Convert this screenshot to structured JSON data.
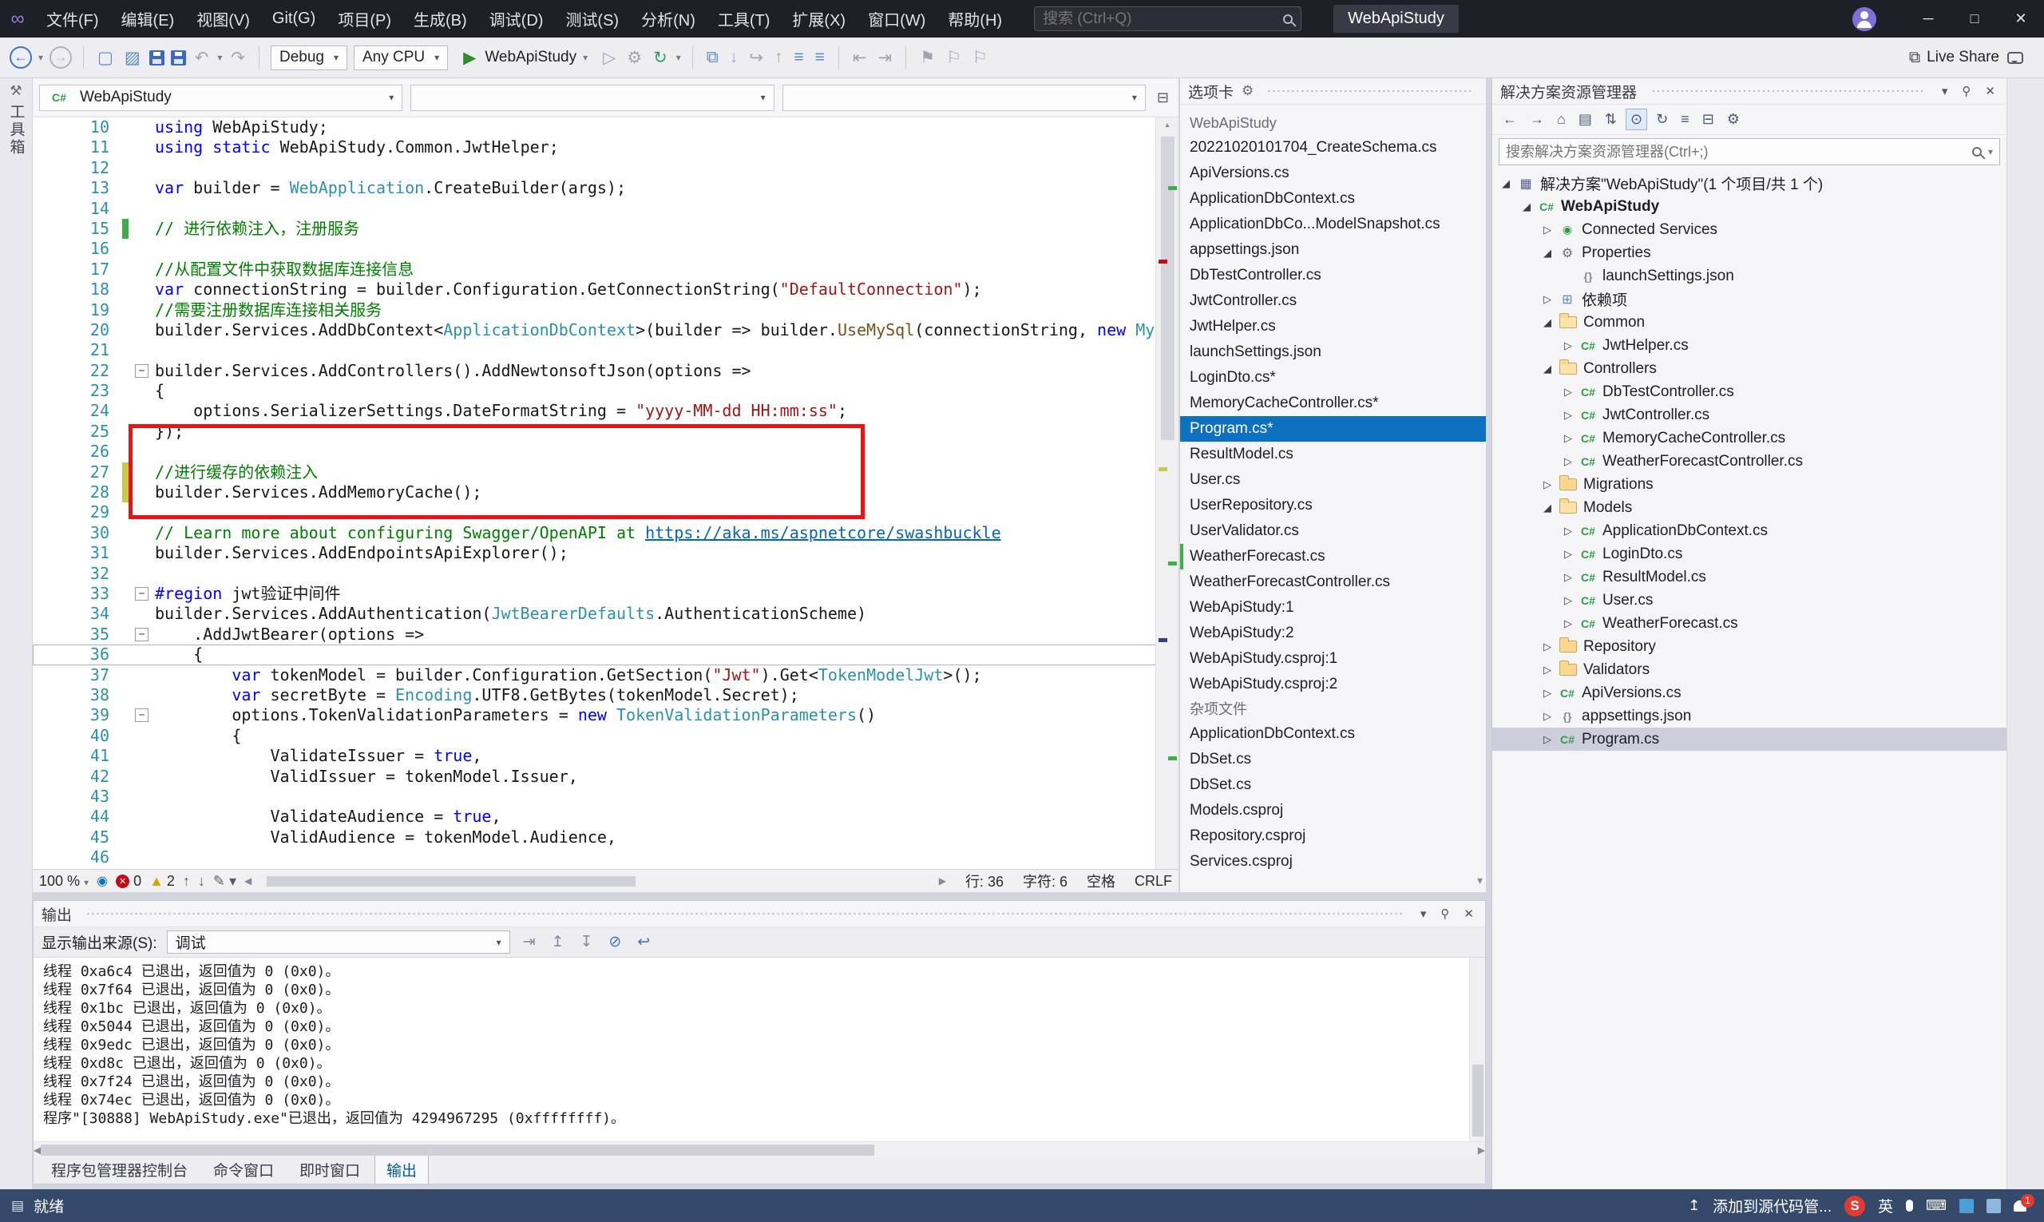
{
  "colors": {
    "accent": "#0e70c0",
    "selection_gray": "#cccedb",
    "error_red": "#c50b17",
    "changed_green": "#3fae49",
    "modified_yellow": "#c9c94a",
    "annotation_red": "#ee1111"
  },
  "titlebar": {
    "menus": [
      "文件(F)",
      "编辑(E)",
      "视图(V)",
      "Git(G)",
      "项目(P)",
      "生成(B)",
      "调试(D)",
      "测试(S)",
      "分析(N)",
      "工具(T)",
      "扩展(X)",
      "窗口(W)",
      "帮助(H)"
    ],
    "search_placeholder": "搜索 (Ctrl+Q)",
    "window_title": "WebApiStudy"
  },
  "toolbar": {
    "debug_config": "Debug",
    "platform": "Any CPU",
    "run_target": "WebApiStudy",
    "live_share": "Live Share"
  },
  "left_strip": {
    "toolbox": "工具箱"
  },
  "editor": {
    "nav": {
      "project": "WebApiStudy"
    },
    "status": {
      "zoom": "100 %",
      "errors": "0",
      "warnings": "2",
      "line": "行: 36",
      "col": "字符: 6",
      "space": "空格",
      "eol": "CRLF"
    },
    "code": {
      "lines": [
        {
          "n": 10,
          "toks": [
            [
              "k",
              "using"
            ],
            [
              "pl",
              " WebApiStudy;"
            ]
          ]
        },
        {
          "n": 11,
          "toks": [
            [
              "k",
              "using"
            ],
            [
              "pl",
              " "
            ],
            [
              "k",
              "static"
            ],
            [
              "pl",
              " WebApiStudy.Common.JwtHelper;"
            ]
          ]
        },
        {
          "n": 12,
          "toks": []
        },
        {
          "n": 13,
          "toks": [
            [
              "k",
              "var"
            ],
            [
              "pl",
              " builder = "
            ],
            [
              "ty",
              "WebApplication"
            ],
            [
              "pl",
              ".CreateBuilder(args);"
            ]
          ]
        },
        {
          "n": 14,
          "toks": []
        },
        {
          "n": 15,
          "toks": [
            [
              "cm",
              "// 进行依赖注入，注册服务"
            ]
          ],
          "chg": "green"
        },
        {
          "n": 16,
          "toks": []
        },
        {
          "n": 17,
          "toks": [
            [
              "cm",
              "//从配置文件中获取数据库连接信息"
            ]
          ]
        },
        {
          "n": 18,
          "toks": [
            [
              "k",
              "var"
            ],
            [
              "pl",
              " connectionString = builder.Configuration.GetConnectionString("
            ],
            [
              "st",
              "\"DefaultConnection\""
            ],
            [
              "pl",
              ");"
            ]
          ]
        },
        {
          "n": 19,
          "toks": [
            [
              "cm",
              "//需要注册数据库连接相关服务"
            ]
          ]
        },
        {
          "n": 20,
          "toks": [
            [
              "pl",
              "builder.Services.AddDbContext<"
            ],
            [
              "ty",
              "ApplicationDbContext"
            ],
            [
              "pl",
              ">(builder => builder."
            ],
            [
              "me",
              "UseMySql"
            ],
            [
              "pl",
              "(connectionString, "
            ],
            [
              "k",
              "new"
            ],
            [
              "pl",
              " "
            ],
            [
              "ty",
              "MySqlServerVersion"
            ],
            [
              "pl",
              "("
            ],
            [
              "k",
              "new"
            ]
          ]
        },
        {
          "n": 21,
          "toks": []
        },
        {
          "n": 22,
          "toks": [
            [
              "pl",
              "builder.Services.AddControllers().AddNewtonsoftJson(options =>"
            ]
          ],
          "fold": true
        },
        {
          "n": 23,
          "toks": [
            [
              "pl",
              "{"
            ]
          ]
        },
        {
          "n": 24,
          "toks": [
            [
              "pl",
              "    options.SerializerSettings.DateFormatString = "
            ],
            [
              "st",
              "\"yyyy-MM-dd HH:mm:ss\""
            ],
            [
              "pl",
              ";"
            ]
          ]
        },
        {
          "n": 25,
          "toks": [
            [
              "pl",
              "});"
            ]
          ]
        },
        {
          "n": 26,
          "toks": []
        },
        {
          "n": 27,
          "toks": [
            [
              "cm",
              "//进行缓存的依赖注入"
            ]
          ],
          "chg": "yellow"
        },
        {
          "n": 28,
          "toks": [
            [
              "pl",
              "builder.Services.AddMemoryCache();"
            ]
          ],
          "chg": "yellow"
        },
        {
          "n": 29,
          "toks": []
        },
        {
          "n": 30,
          "toks": [
            [
              "cm",
              "// Learn more about configuring Swagger/OpenAPI at "
            ],
            [
              "ur",
              "https://aka.ms/aspnetcore/swashbuckle"
            ]
          ]
        },
        {
          "n": 31,
          "toks": [
            [
              "pl",
              "builder.Services.AddEndpointsApiExplorer();"
            ]
          ]
        },
        {
          "n": 32,
          "toks": []
        },
        {
          "n": 33,
          "toks": [
            [
              "k",
              "#region"
            ],
            [
              "pl",
              " jwt验证中间件"
            ]
          ],
          "fold": true
        },
        {
          "n": 34,
          "toks": [
            [
              "pl",
              "builder.Services.AddAuthentication("
            ],
            [
              "ty",
              "JwtBearerDefaults"
            ],
            [
              "pl",
              ".AuthenticationScheme)"
            ]
          ]
        },
        {
          "n": 35,
          "toks": [
            [
              "pl",
              "    .AddJwtBearer(options =>"
            ]
          ],
          "fold": true
        },
        {
          "n": 36,
          "toks": [
            [
              "pl",
              "    {"
            ]
          ],
          "cur": true
        },
        {
          "n": 37,
          "toks": [
            [
              "pl",
              "        "
            ],
            [
              "k",
              "var"
            ],
            [
              "pl",
              " tokenModel = builder.Configuration.GetSection("
            ],
            [
              "st",
              "\"Jwt\""
            ],
            [
              "pl",
              ").Get<"
            ],
            [
              "ty",
              "TokenModelJwt"
            ],
            [
              "pl",
              ">();"
            ]
          ]
        },
        {
          "n": 38,
          "toks": [
            [
              "pl",
              "        "
            ],
            [
              "k",
              "var"
            ],
            [
              "pl",
              " secretByte = "
            ],
            [
              "ty",
              "Encoding"
            ],
            [
              "pl",
              ".UTF8.GetBytes(tokenModel.Secret);"
            ]
          ]
        },
        {
          "n": 39,
          "toks": [
            [
              "pl",
              "        options.TokenValidationParameters = "
            ],
            [
              "k",
              "new"
            ],
            [
              "pl",
              " "
            ],
            [
              "ty",
              "TokenValidationParameters"
            ],
            [
              "pl",
              "()"
            ]
          ],
          "fold": true
        },
        {
          "n": 40,
          "toks": [
            [
              "pl",
              "        {"
            ]
          ]
        },
        {
          "n": 41,
          "toks": [
            [
              "pl",
              "            ValidateIssuer = "
            ],
            [
              "k",
              "true"
            ],
            [
              "pl",
              ","
            ]
          ]
        },
        {
          "n": 42,
          "toks": [
            [
              "pl",
              "            ValidIssuer = tokenModel.Issuer,"
            ]
          ]
        },
        {
          "n": 43,
          "toks": []
        },
        {
          "n": 44,
          "toks": [
            [
              "pl",
              "            ValidateAudience = "
            ],
            [
              "k",
              "true"
            ],
            [
              "pl",
              ","
            ]
          ]
        },
        {
          "n": 45,
          "toks": [
            [
              "pl",
              "            ValidAudience = tokenModel.Audience,"
            ]
          ]
        },
        {
          "n": 46,
          "toks": []
        }
      ]
    }
  },
  "tabs_panel": {
    "title": "选项卡",
    "groups": [
      {
        "header": "WebApiStudy",
        "items": [
          {
            "label": "20221020101704_CreateSchema.cs"
          },
          {
            "label": "ApiVersions.cs"
          },
          {
            "label": "ApplicationDbContext.cs"
          },
          {
            "label": "ApplicationDbCo...ModelSnapshot.cs"
          },
          {
            "label": "appsettings.json"
          },
          {
            "label": "DbTestController.cs"
          },
          {
            "label": "JwtController.cs"
          },
          {
            "label": "JwtHelper.cs"
          },
          {
            "label": "launchSettings.json"
          },
          {
            "label": "LoginDto.cs*"
          },
          {
            "label": "MemoryCacheController.cs*"
          },
          {
            "label": "Program.cs*",
            "selected": true
          },
          {
            "label": "ResultModel.cs"
          },
          {
            "label": "User.cs"
          },
          {
            "label": "UserRepository.cs"
          },
          {
            "label": "UserValidator.cs"
          },
          {
            "label": "WeatherForecast.cs",
            "mark": "green"
          },
          {
            "label": "WeatherForecastController.cs"
          },
          {
            "label": "WebApiStudy:1"
          },
          {
            "label": "WebApiStudy:2"
          },
          {
            "label": "WebApiStudy.csproj:1"
          },
          {
            "label": "WebApiStudy.csproj:2"
          }
        ]
      },
      {
        "header": "杂项文件",
        "items": [
          {
            "label": "ApplicationDbContext.cs"
          },
          {
            "label": "DbSet.cs"
          },
          {
            "label": "DbSet.cs"
          },
          {
            "label": "Models.csproj"
          },
          {
            "label": "Repository.csproj"
          },
          {
            "label": "Services.csproj"
          }
        ]
      }
    ]
  },
  "solution_explorer": {
    "title": "解决方案资源管理器",
    "search_placeholder": "搜索解决方案资源管理器(Ctrl+;)",
    "tree": [
      {
        "label": "解决方案\"WebApiStudy\"(1 个项目/共 1 个)",
        "indent": 0,
        "arrow": "exp",
        "icon": "solution"
      },
      {
        "label": "WebApiStudy",
        "indent": 1,
        "arrow": "exp",
        "icon": "project",
        "bold": true
      },
      {
        "label": "Connected Services",
        "indent": 2,
        "arrow": "col",
        "icon": "services"
      },
      {
        "label": "Properties",
        "indent": 2,
        "arrow": "exp",
        "icon": "properties"
      },
      {
        "label": "launchSettings.json",
        "indent": 3,
        "arrow": "none",
        "icon": "json"
      },
      {
        "label": "依赖项",
        "indent": 2,
        "arrow": "col",
        "icon": "deps"
      },
      {
        "label": "Common",
        "indent": 2,
        "arrow": "exp",
        "icon": "folder-open"
      },
      {
        "label": "JwtHelper.cs",
        "indent": 3,
        "arrow": "col",
        "icon": "cs"
      },
      {
        "label": "Controllers",
        "indent": 2,
        "arrow": "exp",
        "icon": "folder-open"
      },
      {
        "label": "DbTestController.cs",
        "indent": 3,
        "arrow": "col",
        "icon": "cs"
      },
      {
        "label": "JwtController.cs",
        "indent": 3,
        "arrow": "col",
        "icon": "cs"
      },
      {
        "label": "MemoryCacheController.cs",
        "indent": 3,
        "arrow": "col",
        "icon": "cs"
      },
      {
        "label": "WeatherForecastController.cs",
        "indent": 3,
        "arrow": "col",
        "icon": "cs"
      },
      {
        "label": "Migrations",
        "indent": 2,
        "arrow": "col",
        "icon": "folder"
      },
      {
        "label": "Models",
        "indent": 2,
        "arrow": "exp",
        "icon": "folder-open"
      },
      {
        "label": "ApplicationDbContext.cs",
        "indent": 3,
        "arrow": "col",
        "icon": "cs"
      },
      {
        "label": "LoginDto.cs",
        "indent": 3,
        "arrow": "col",
        "icon": "cs"
      },
      {
        "label": "ResultModel.cs",
        "indent": 3,
        "arrow": "col",
        "icon": "cs"
      },
      {
        "label": "User.cs",
        "indent": 3,
        "arrow": "col",
        "icon": "cs"
      },
      {
        "label": "WeatherForecast.cs",
        "indent": 3,
        "arrow": "col",
        "icon": "cs"
      },
      {
        "label": "Repository",
        "indent": 2,
        "arrow": "col",
        "icon": "folder"
      },
      {
        "label": "Validators",
        "indent": 2,
        "arrow": "col",
        "icon": "folder"
      },
      {
        "label": "ApiVersions.cs",
        "indent": 2,
        "arrow": "col",
        "icon": "cs"
      },
      {
        "label": "appsettings.json",
        "indent": 2,
        "arrow": "col",
        "icon": "json"
      },
      {
        "label": "Program.cs",
        "indent": 2,
        "arrow": "col",
        "icon": "cs",
        "selected": true
      }
    ]
  },
  "output": {
    "title": "输出",
    "source_label": "显示输出来源(S):",
    "source_value": "调试",
    "lines": [
      "线程 0xa6c4 已退出，返回值为 0 (0x0)。",
      "线程 0x7f64 已退出，返回值为 0 (0x0)。",
      "线程 0x1bc 已退出，返回值为 0 (0x0)。",
      "线程 0x5044 已退出，返回值为 0 (0x0)。",
      "线程 0x9edc 已退出，返回值为 0 (0x0)。",
      "线程 0xd8c 已退出，返回值为 0 (0x0)。",
      "线程 0x7f24 已退出，返回值为 0 (0x0)。",
      "线程 0x74ec 已退出，返回值为 0 (0x0)。",
      "程序\"[30888] WebApiStudy.exe\"已退出，返回值为 4294967295 (0xffffffff)。"
    ],
    "tabs": [
      "程序包管理器控制台",
      "命令窗口",
      "即时窗口",
      "输出"
    ],
    "active_tab": "输出"
  },
  "statusbar": {
    "ready": "就绪",
    "scm": "添加到源代码管...",
    "ime": "英",
    "bell_count": "1"
  }
}
